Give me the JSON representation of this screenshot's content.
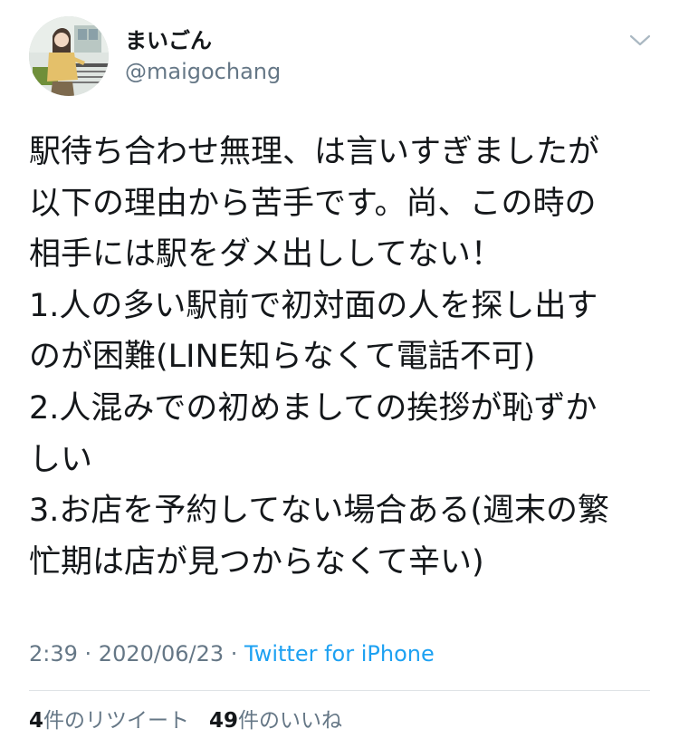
{
  "user": {
    "display_name": "まいごん",
    "handle": "@maigochang"
  },
  "tweet": {
    "lines": [
      "駅待ち合わせ無理、は言いすぎましたが",
      "以下の理由から苦手です。尚、この時の",
      "相手には駅をダメ出ししてない！",
      "1.人の多い駅前で初対面の人を探し出す",
      "のが困難(LINE知らなくて電話不可)",
      "2.人混みでの初めましての挨拶が恥ずか",
      "しい",
      "3.お店を予約してない場合ある(週末の繁",
      "忙期は店が見つからなくて辛い)"
    ]
  },
  "meta": {
    "time": "2:39",
    "sep1": " · ",
    "date": "2020/06/23",
    "sep2": " · ",
    "source": "Twitter for iPhone"
  },
  "stats": {
    "retweets_count": "4",
    "retweets_label": "件のリツイート",
    "likes_count": "49",
    "likes_label": "件のいいね"
  },
  "icons": {
    "more": "chevron-down-icon",
    "avatar": "avatar"
  },
  "colors": {
    "text": "#14171a",
    "secondary": "#657786",
    "link": "#1da1f2",
    "divider": "#dfe3e6"
  }
}
